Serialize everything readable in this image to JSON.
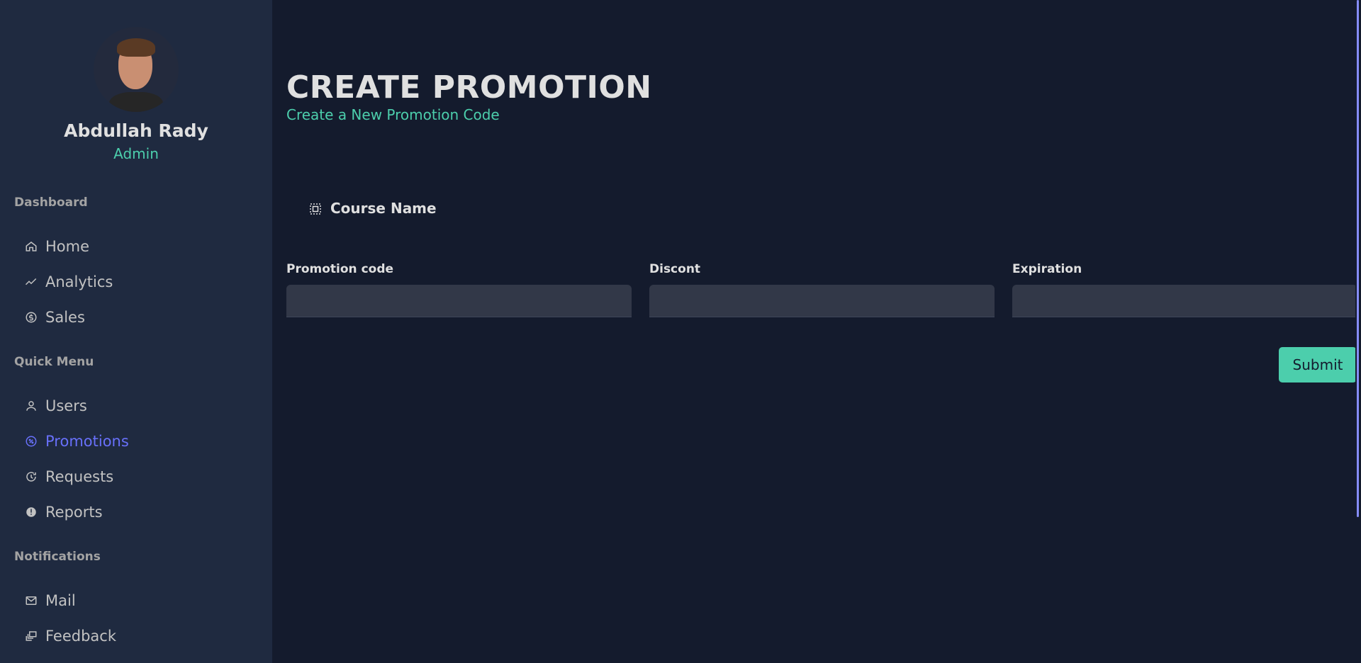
{
  "user": {
    "name": "Abdullah Rady",
    "role": "Admin"
  },
  "sidebar": {
    "sections": [
      {
        "title": "Dashboard",
        "items": [
          {
            "label": "Home",
            "icon": "home-icon"
          },
          {
            "label": "Analytics",
            "icon": "trend-icon"
          },
          {
            "label": "Sales",
            "icon": "dollar-icon"
          }
        ]
      },
      {
        "title": "Quick Menu",
        "items": [
          {
            "label": "Users",
            "icon": "user-icon"
          },
          {
            "label": "Promotions",
            "icon": "badge-icon",
            "active": true
          },
          {
            "label": "Requests",
            "icon": "request-icon"
          },
          {
            "label": "Reports",
            "icon": "alert-icon"
          }
        ]
      },
      {
        "title": "Notifications",
        "items": [
          {
            "label": "Mail",
            "icon": "mail-icon"
          },
          {
            "label": "Feedback",
            "icon": "feedback-icon"
          }
        ]
      }
    ]
  },
  "header": {
    "title": "CREATE PROMOTION",
    "subtitle": "Create a New Promotion Code"
  },
  "course": {
    "label": "Course Name"
  },
  "form": {
    "fields": [
      {
        "label": "Promotion code",
        "value": "",
        "placeholder": ""
      },
      {
        "label": "Discont",
        "value": "",
        "placeholder": ""
      },
      {
        "label": "Expiration",
        "value": "",
        "placeholder": ""
      }
    ],
    "submit_label": "Submit"
  },
  "colors": {
    "accent": "#4cceac",
    "active": "#6870fa",
    "background": "#141b2d",
    "sidebar": "#1f2a40"
  }
}
